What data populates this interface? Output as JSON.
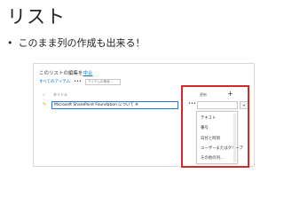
{
  "slide": {
    "title": "リスト",
    "bullet": "•",
    "bullet_text": "このまま列の作成も出来る！"
  },
  "screenshot": {
    "edit_prefix": "このリストの編集を",
    "edit_link": "中止",
    "view_label": "すべてのアイテム",
    "view_more": "•••",
    "search_placeholder": "アイテムの検索...",
    "columns": {
      "check": "✓",
      "title": "タイトル",
      "more": "更新",
      "add": "+"
    },
    "row": {
      "icon": "✎",
      "title": "Microsoft SharePoint Foundation について ※",
      "more": "•••",
      "scroll": "▾"
    },
    "dropdown_items": [
      "テキスト",
      "番号",
      "日付と時刻",
      "ユーザーまたはグループ",
      "その他の列..."
    ]
  },
  "highlight_color": "#d22a2a"
}
